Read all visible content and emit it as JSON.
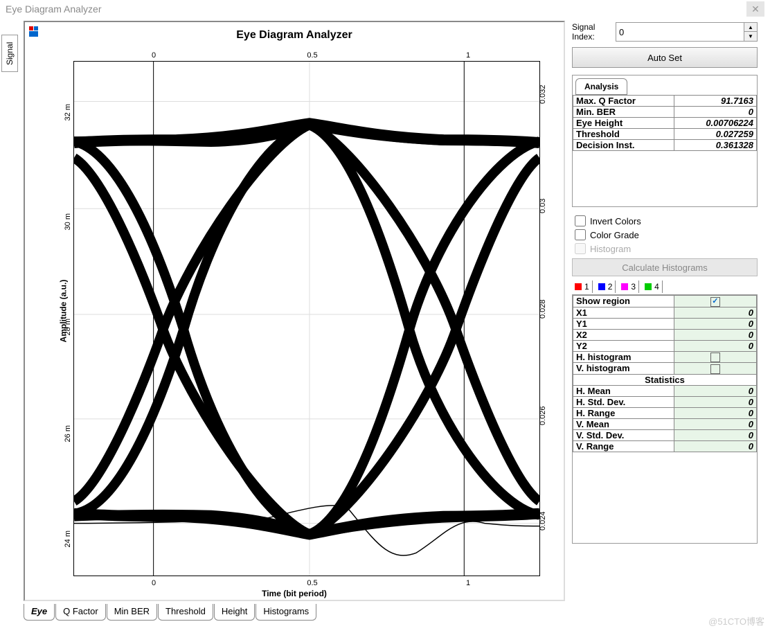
{
  "window": {
    "title": "Eye Diagram Analyzer"
  },
  "left": {
    "signal_tab": "Signal"
  },
  "chart": {
    "title": "Eye Diagram Analyzer",
    "ylabel": "Amplitude (a.u.)",
    "xlabel": "Time (bit period)",
    "y_ticks": [
      "24 m",
      "26 m",
      "28 m",
      "30 m",
      "32 m"
    ],
    "y2_ticks": [
      "0.024",
      "0.026",
      "0.028",
      "0.03",
      "0.032"
    ],
    "x_ticks": [
      "0",
      "0.5",
      "1"
    ]
  },
  "bottom_tabs": [
    "Eye",
    "Q Factor",
    "Min BER",
    "Threshold",
    "Height",
    "Histograms"
  ],
  "right": {
    "signal_index_label": "Signal Index:",
    "signal_index_value": "0",
    "auto_set": "Auto Set",
    "analysis_tab": "Analysis",
    "analysis_rows": [
      {
        "label": "Max. Q Factor",
        "value": "91.7163"
      },
      {
        "label": "Min. BER",
        "value": "0"
      },
      {
        "label": "Eye Height",
        "value": "0.00706224"
      },
      {
        "label": "Threshold",
        "value": "0.027259"
      },
      {
        "label": "Decision Inst.",
        "value": "0.361328"
      }
    ],
    "invert_colors": "Invert Colors",
    "color_grade": "Color Grade",
    "histogram": "Histogram",
    "calc_hist": "Calculate Histograms",
    "color_tabs": [
      {
        "n": "1",
        "color": "#ff0000"
      },
      {
        "n": "2",
        "color": "#0000ff"
      },
      {
        "n": "3",
        "color": "#ff00ff"
      },
      {
        "n": "4",
        "color": "#00cc00"
      }
    ],
    "region_rows": [
      {
        "label": "Show region",
        "type": "check",
        "checked": true
      },
      {
        "label": "X1",
        "type": "val",
        "value": "0"
      },
      {
        "label": "Y1",
        "type": "val",
        "value": "0"
      },
      {
        "label": "X2",
        "type": "val",
        "value": "0"
      },
      {
        "label": "Y2",
        "type": "val",
        "value": "0"
      },
      {
        "label": "H. histogram",
        "type": "check",
        "checked": false
      },
      {
        "label": "V. histogram",
        "type": "check",
        "checked": false
      }
    ],
    "statistics_header": "Statistics",
    "stats_rows": [
      {
        "label": "H. Mean",
        "value": "0"
      },
      {
        "label": "H. Std. Dev.",
        "value": "0"
      },
      {
        "label": "H. Range",
        "value": "0"
      },
      {
        "label": "V. Mean",
        "value": "0"
      },
      {
        "label": "V. Std. Dev.",
        "value": "0"
      },
      {
        "label": "V. Range",
        "value": "0"
      }
    ]
  },
  "watermark": "@51CTO博客",
  "chart_data": {
    "type": "line",
    "title": "Eye Diagram Analyzer",
    "xlabel": "Time (bit period)",
    "ylabel": "Amplitude (a.u.)",
    "xlim": [
      -0.25,
      1.25
    ],
    "ylim": [
      0.023,
      0.0325
    ],
    "description": "Eye diagram showing overlaid signal transitions with crossings near t=0 and t=1, high rail ~0.0315, low rail ~0.024, eye opening centered near t=0.5, Q factor ~91.72"
  }
}
